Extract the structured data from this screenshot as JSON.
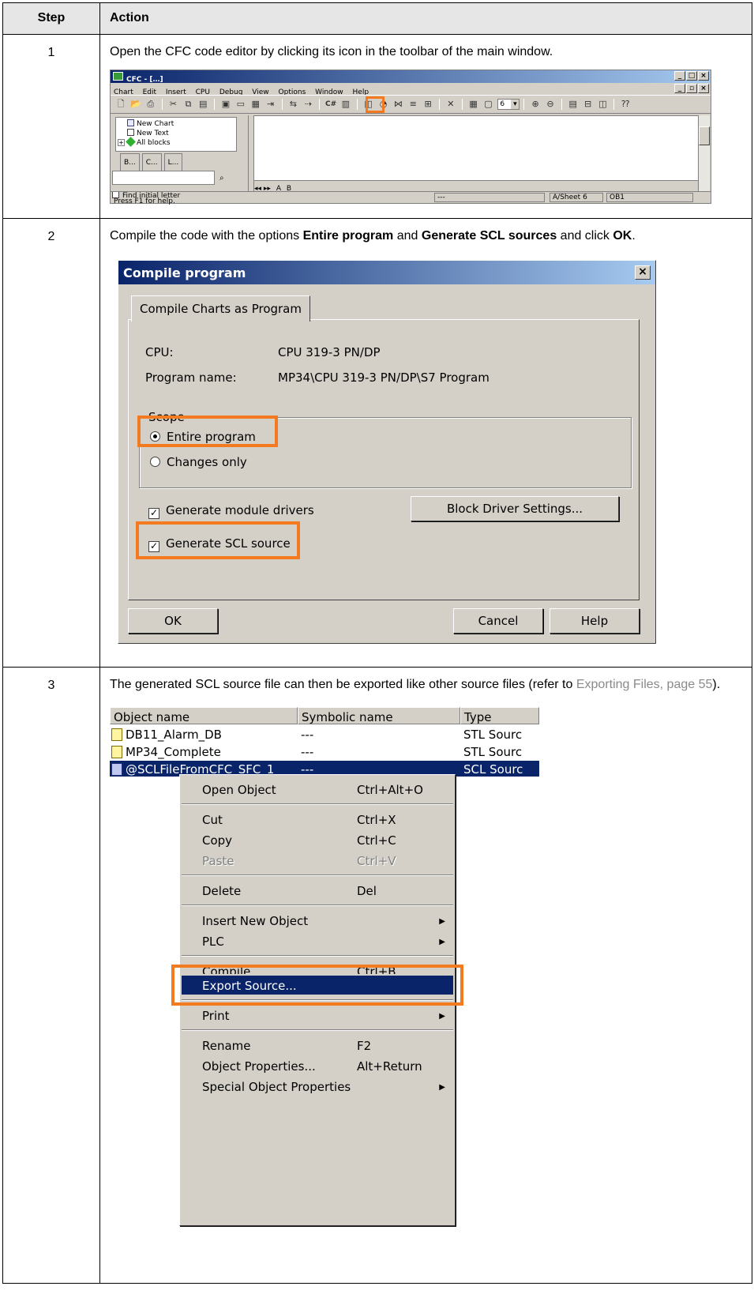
{
  "table": {
    "header_step": "Step",
    "header_action": "Action"
  },
  "steps": [
    {
      "num": "1",
      "text": "Open the CFC code editor by clicking its icon in the toolbar of the main window."
    },
    {
      "num": "2",
      "text_1": "Compile the code with the options ",
      "bold_1": "Entire program",
      "text_2": " and ",
      "bold_2": "Generate SCL sources",
      "text_3": " and click ",
      "bold_3": "OK",
      "text_4": "."
    },
    {
      "num": "3",
      "text_1": "The generated SCL source file can then be exported like other source files (refer to ",
      "link": "Exporting Files, page 55",
      "text_2": ")."
    }
  ],
  "cfc_window": {
    "title": "CFC - […]",
    "menu": [
      "Chart",
      "Edit",
      "Insert",
      "CPU",
      "Debug",
      "View",
      "Options",
      "Window",
      "Help"
    ],
    "zoom_value": "6",
    "tree": [
      "New Chart",
      "New Text",
      "All blocks"
    ],
    "tabs": [
      "B...",
      "C...",
      "L..."
    ],
    "find_initial_letter": "Find initial letter",
    "sheet_tabs": [
      "A",
      "B"
    ],
    "status_help": "Press F1 for help.",
    "status_dash": "---",
    "status_sheet": "A/Sheet 6",
    "status_block": "OB1"
  },
  "compile_dialog": {
    "title": "Compile program",
    "tab": "Compile Charts as Program",
    "cpu_label": "CPU:",
    "cpu_value": "CPU 319-3 PN/DP",
    "program_label": "Program name:",
    "program_value": "MP34\\CPU 319-3 PN/DP\\S7 Program",
    "scope_label": "Scope",
    "radio_entire": "Entire program",
    "radio_changes": "Changes only",
    "chk_module": "Generate module drivers",
    "chk_scl": "Generate SCL source",
    "btn_block_driver": "Block Driver Settings...",
    "btn_ok": "OK",
    "btn_cancel": "Cancel",
    "btn_help": "Help"
  },
  "object_list": {
    "columns": [
      "Object name",
      "Symbolic name",
      "Type"
    ],
    "rows": [
      {
        "name": "DB11_Alarm_DB",
        "symbolic": "---",
        "type": "STL Sourc"
      },
      {
        "name": "MP34_Complete",
        "symbolic": "---",
        "type": "STL Sourc"
      },
      {
        "name": "@SCLFileFromCFC_SFC_1",
        "symbolic": "---",
        "type": "SCL Sourc"
      }
    ]
  },
  "context_menu": {
    "open_object": "Open Object",
    "open_object_sc": "Ctrl+Alt+O",
    "cut": "Cut",
    "cut_sc": "Ctrl+X",
    "copy": "Copy",
    "copy_sc": "Ctrl+C",
    "paste": "Paste",
    "paste_sc": "Ctrl+V",
    "delete": "Delete",
    "delete_sc": "Del",
    "insert_new_object": "Insert New Object",
    "plc": "PLC",
    "compile": "Compile",
    "compile_sc": "Ctrl+B",
    "export_source": "Export Source...",
    "print": "Print",
    "rename": "Rename",
    "rename_sc": "F2",
    "object_properties": "Object Properties...",
    "object_properties_sc": "Alt+Return",
    "special_object_properties": "Special Object Properties"
  },
  "highlight_color": "#f47a20"
}
